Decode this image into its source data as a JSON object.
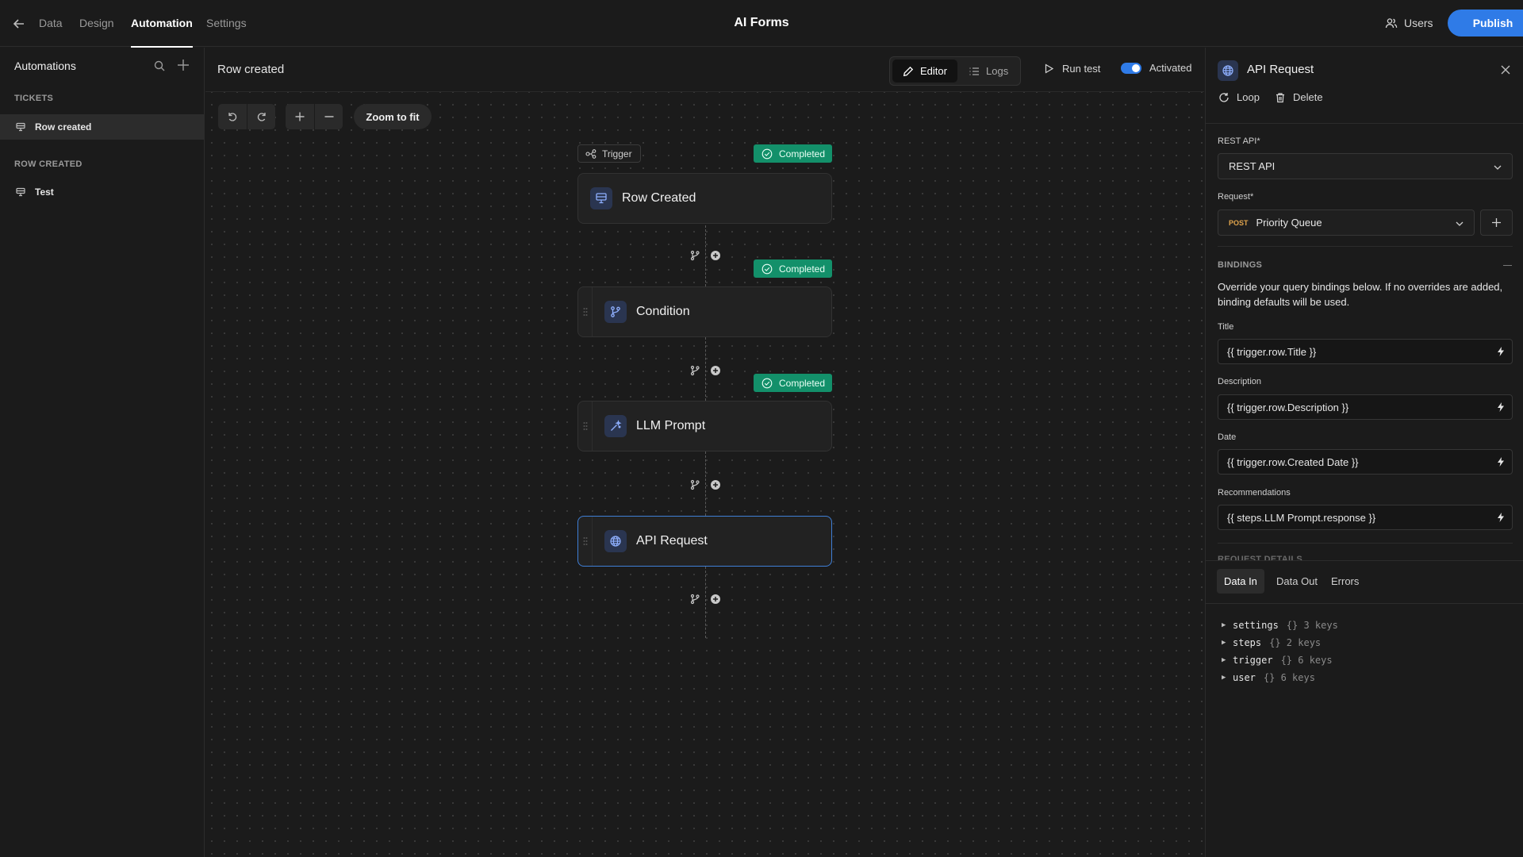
{
  "topbar": {
    "tabs": [
      "Data",
      "Design",
      "Automation",
      "Settings"
    ],
    "active_tab": "Automation",
    "app_title": "AI Forms",
    "users_label": "Users",
    "publish_label": "Publish"
  },
  "sidebar": {
    "title": "Automations",
    "sections": [
      {
        "title": "TICKETS",
        "items": [
          {
            "label": "Row created",
            "active": true
          }
        ]
      },
      {
        "title": "ROW CREATED",
        "items": [
          {
            "label": "Test",
            "active": false
          }
        ]
      }
    ]
  },
  "canvas": {
    "title": "Row created",
    "editor_label": "Editor",
    "logs_label": "Logs",
    "run_test_label": "Run test",
    "activated_label": "Activated",
    "activated": true,
    "zoom_fit_label": "Zoom to fit",
    "trigger_tag": "Trigger",
    "nodes": [
      {
        "label": "Row Created",
        "icon": "table-row-icon",
        "status": "Completed"
      },
      {
        "label": "Condition",
        "icon": "branch-icon",
        "status": "Completed"
      },
      {
        "label": "LLM Prompt",
        "icon": "sparkle-prompt-icon",
        "status": "Completed"
      },
      {
        "label": "API Request",
        "icon": "globe-icon",
        "status": "",
        "selected": true
      }
    ]
  },
  "panel": {
    "title": "API Request",
    "loop_label": "Loop",
    "delete_label": "Delete",
    "rest_api_label": "REST API*",
    "rest_api_value": "REST API",
    "request_label": "Request*",
    "request_method": "POST",
    "request_value": "Priority Queue",
    "bindings_title": "BINDINGS",
    "bindings_help": "Override your query bindings below. If no overrides are added, binding defaults will be used.",
    "fields": [
      {
        "label": "Title",
        "value": "{{ trigger.row.Title }}"
      },
      {
        "label": "Description",
        "value": "{{ trigger.row.Description }}"
      },
      {
        "label": "Date",
        "value": "{{ trigger.row.Created Date }}"
      },
      {
        "label": "Recommendations",
        "value": "{{ steps.LLM Prompt.response }}"
      }
    ],
    "cut_section": "REQUEST DETAILS",
    "data_tabs": [
      "Data In",
      "Data Out",
      "Errors"
    ],
    "active_data_tab": "Data In",
    "tree": [
      {
        "key": "settings",
        "meta": "{} 3 keys"
      },
      {
        "key": "steps",
        "meta": "{} 2 keys"
      },
      {
        "key": "trigger",
        "meta": "{} 6 keys"
      },
      {
        "key": "user",
        "meta": "{} 6 keys"
      }
    ]
  },
  "colors": {
    "background": "#1b1b1b",
    "accent": "#2f7be7",
    "completed": "#13906a",
    "selected_border": "#3f7fd6"
  }
}
